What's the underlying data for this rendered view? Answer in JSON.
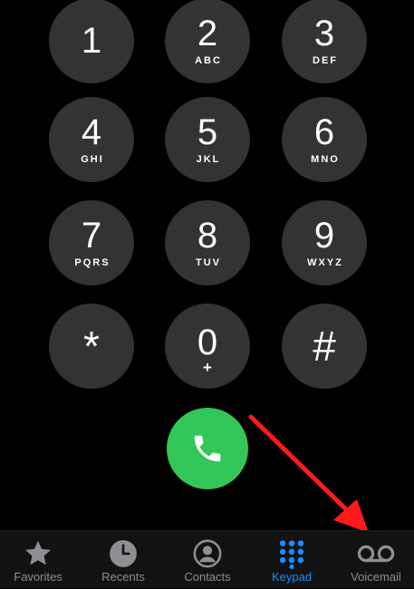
{
  "colors": {
    "background": "#000000",
    "key": "#333333",
    "call": "#33c759",
    "active_tab": "#1a8cff",
    "inactive_tab": "#8e8e93",
    "annotation_arrow": "#ff1a1a"
  },
  "keypad": {
    "keys": [
      {
        "digit": "1",
        "letters": ""
      },
      {
        "digit": "2",
        "letters": "ABC"
      },
      {
        "digit": "3",
        "letters": "DEF"
      },
      {
        "digit": "4",
        "letters": "GHI"
      },
      {
        "digit": "5",
        "letters": "JKL"
      },
      {
        "digit": "6",
        "letters": "MNO"
      },
      {
        "digit": "7",
        "letters": "PQRS"
      },
      {
        "digit": "8",
        "letters": "TUV"
      },
      {
        "digit": "9",
        "letters": "WXYZ"
      },
      {
        "digit": "*",
        "letters": ""
      },
      {
        "digit": "0",
        "letters": "+"
      },
      {
        "digit": "#",
        "letters": ""
      }
    ]
  },
  "call_button": {
    "icon": "phone-icon"
  },
  "tabbar": {
    "active": "Keypad",
    "tabs": [
      {
        "label": "Favorites",
        "icon": "star-icon"
      },
      {
        "label": "Recents",
        "icon": "clock-icon"
      },
      {
        "label": "Contacts",
        "icon": "contact-icon"
      },
      {
        "label": "Keypad",
        "icon": "keypad-icon"
      },
      {
        "label": "Voicemail",
        "icon": "voicemail-icon"
      }
    ]
  }
}
